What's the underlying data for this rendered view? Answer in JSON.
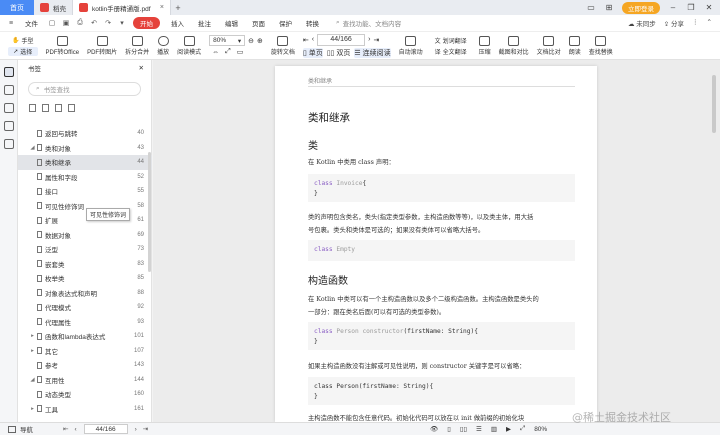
{
  "tabs": {
    "home": "首页",
    "t1": "稻壳",
    "t2": "kotlin手册精通版.pdf",
    "login": "立即登录"
  },
  "menu": {
    "file": "文件",
    "kaiban": "开始",
    "insert": "插入",
    "annotate": "批注",
    "edit": "编辑",
    "page": "页面",
    "protect": "保护",
    "convert": "转换",
    "search_placeholder": "查找功能、文档内容",
    "sync": "未同步",
    "share": "分享"
  },
  "toolbar": {
    "hand": "手型",
    "select": "选择",
    "pdf_office": "PDF转Office",
    "pdf_image": "PDF转图片",
    "split_merge": "拆分合并",
    "play": "播放",
    "read_mode": "阅读模式",
    "zoom": "80%",
    "rotate": "旋转文档",
    "single": "单页",
    "double": "双页",
    "continuous": "连续阅读",
    "auto_scroll": "自动滚动",
    "translate_label": "划词翻译",
    "full_translate": "全文翻译",
    "compress": "压缩",
    "screenshot": "截图和对比",
    "compare": "文档比对",
    "read_aloud": "朗读",
    "find_replace": "查找替换",
    "page_input": "44/166"
  },
  "panel": {
    "title": "书签",
    "search_placeholder": "书签查找",
    "tooltip": "可见性修饰词",
    "items": [
      {
        "label": "返回与跳转",
        "num": "40"
      },
      {
        "label": "类和对象",
        "num": "43"
      },
      {
        "label": "类和继承",
        "num": "44"
      },
      {
        "label": "属性和字段",
        "num": "52"
      },
      {
        "label": "接口",
        "num": "55"
      },
      {
        "label": "可见性修饰词",
        "num": "58"
      },
      {
        "label": "扩展",
        "num": "61"
      },
      {
        "label": "数据对象",
        "num": "69"
      },
      {
        "label": "泛型",
        "num": "73"
      },
      {
        "label": "嵌套类",
        "num": "83"
      },
      {
        "label": "枚举类",
        "num": "85"
      },
      {
        "label": "对象表达式和声明",
        "num": "88"
      },
      {
        "label": "代理模式",
        "num": "92"
      },
      {
        "label": "代理属性",
        "num": "93"
      },
      {
        "label": "函数和lambda表达式",
        "num": "101"
      },
      {
        "label": "其它",
        "num": "107"
      },
      {
        "label": "参考",
        "num": "143"
      },
      {
        "label": "互用性",
        "num": "144"
      },
      {
        "label": "动态类型",
        "num": "160"
      },
      {
        "label": "工具",
        "num": "161"
      }
    ]
  },
  "doc": {
    "running_head": "类和继承",
    "h_main": "类和继承",
    "h_class": "类",
    "p1": "在 Kotlin 中类用 class 声明：",
    "code1_kw": "class",
    "code1_name": "Invoice",
    "code1_rest": "{\n}",
    "p2": "类的声明包含类名，类头(指定类型参数，主构造函数等等)，以及类主体，用大括",
    "p2b": "号包裹。类头和类体是可选的；如果没有类体可以省略大括号。",
    "code2_kw": "class",
    "code2_name": "Empty",
    "h_ctor": "构造函数",
    "p3": "在 Kotlin 中类可以有一个主构造函数以及多个二级构造函数。主构造函数是类头的",
    "p3b": "一部分：跟在类名后面(可以有可选的类型参数)。",
    "code3_kw": "class",
    "code3_name": "Person constructor",
    "code3_rest": "(firstName: String){\n}",
    "p4": "如果主构造函数没有注解或可见性说明，则 constructor 关键字是可以省略：",
    "code4": "class Person(firstName: String){\n}",
    "p5": "主构造函数不能包含任意代码。初始化代码可以放在以 init 做前缀的初始化块"
  },
  "status": {
    "nav": "导航",
    "page": "44/166",
    "zoom": "80%",
    "watermark": "@稀土掘金技术社区"
  }
}
